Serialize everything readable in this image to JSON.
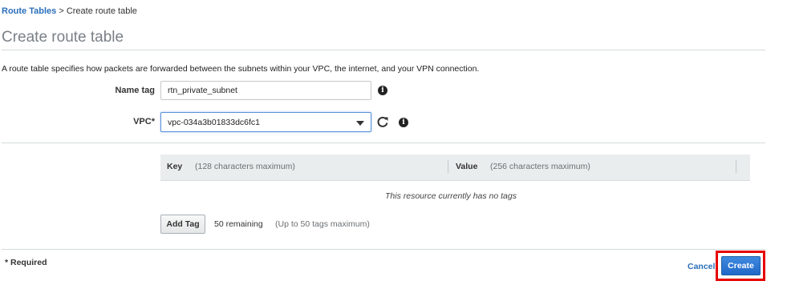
{
  "breadcrumb": {
    "parent": "Route Tables",
    "separator": ">",
    "current": "Create route table"
  },
  "page": {
    "title": "Create route table",
    "description": "A route table specifies how packets are forwarded between the subnets within your VPC, the internet, and your VPN connection."
  },
  "form": {
    "name_tag": {
      "label": "Name tag",
      "value": "rtn_private_subnet"
    },
    "vpc": {
      "label": "VPC*",
      "value": "vpc-034a3b01833dc6fc1"
    }
  },
  "tags": {
    "key_header": "Key",
    "key_hint": "(128 characters maximum)",
    "value_header": "Value",
    "value_hint": "(256 characters maximum)",
    "empty_message": "This resource currently has no tags",
    "add_button": "Add Tag",
    "remaining": "50 remaining",
    "limit": "(Up to 50 tags maximum)"
  },
  "footer": {
    "required_note": "* Required",
    "cancel_label": "Cancel",
    "create_label": "Create"
  },
  "icons": {
    "info": "info-icon",
    "refresh": "refresh-icon",
    "dropdown": "chevron-down-icon"
  },
  "colors": {
    "link": "#2a6fba",
    "primary_button": "#2168c8",
    "highlight": "#e60000"
  }
}
